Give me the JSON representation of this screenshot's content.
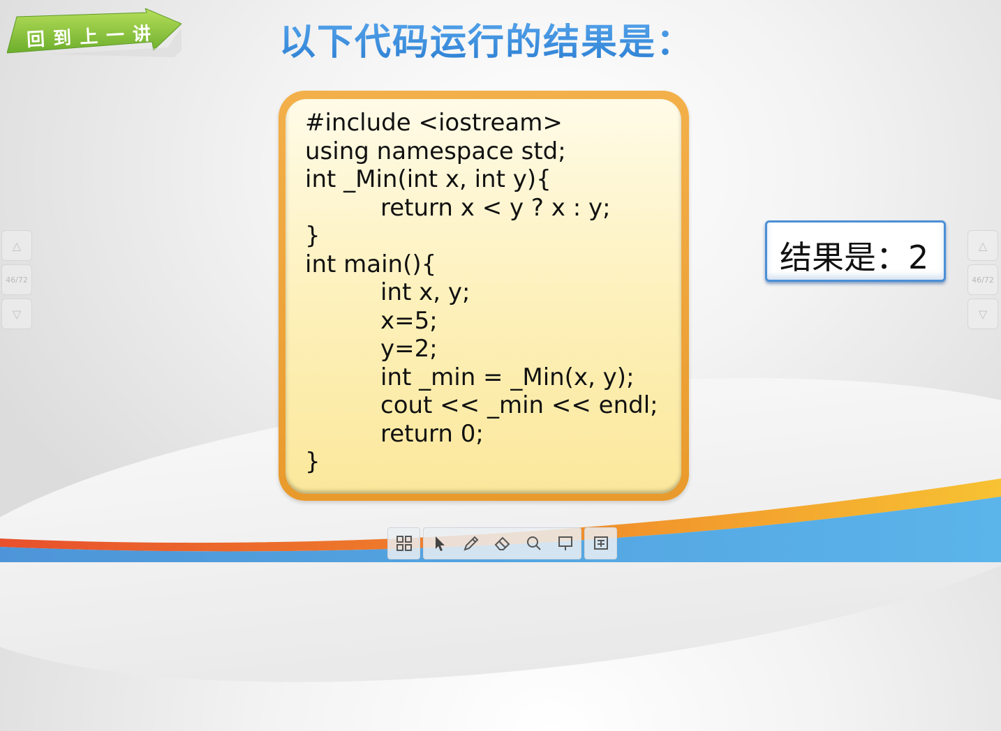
{
  "back_button": {
    "label": "回到上一讲"
  },
  "title": "以下代码运行的结果是：",
  "code_lines": [
    {
      "text": "#include <iostream>",
      "indent": false
    },
    {
      "text": "using namespace std;",
      "indent": false
    },
    {
      "text": "int _Min(int x, int y){",
      "indent": false
    },
    {
      "text": "return x < y ? x : y;",
      "indent": true
    },
    {
      "text": "}",
      "indent": false
    },
    {
      "text": "int main(){",
      "indent": false
    },
    {
      "text": "int x, y;",
      "indent": true
    },
    {
      "text": "x=5;",
      "indent": true
    },
    {
      "text": "y=2;",
      "indent": true
    },
    {
      "text": "int _min = _Min(x, y);",
      "indent": true
    },
    {
      "text": "cout << _min << endl;",
      "indent": true
    },
    {
      "text": "return 0;",
      "indent": true
    },
    {
      "text": "}",
      "indent": false
    }
  ],
  "result": "结果是：2",
  "pager": {
    "page_count": "46/72"
  },
  "toolbar": {
    "tools": [
      "grid-icon",
      "pointer-icon",
      "pen-icon",
      "eraser-icon",
      "search-icon",
      "board-icon",
      "screen-icon"
    ]
  },
  "colors": {
    "title_blue": "#3d8fdc",
    "code_border": "#e99a2c",
    "code_fill": "#fdf0b8",
    "result_border": "#4a8fd6",
    "back_button_green": "#8cc63f"
  }
}
